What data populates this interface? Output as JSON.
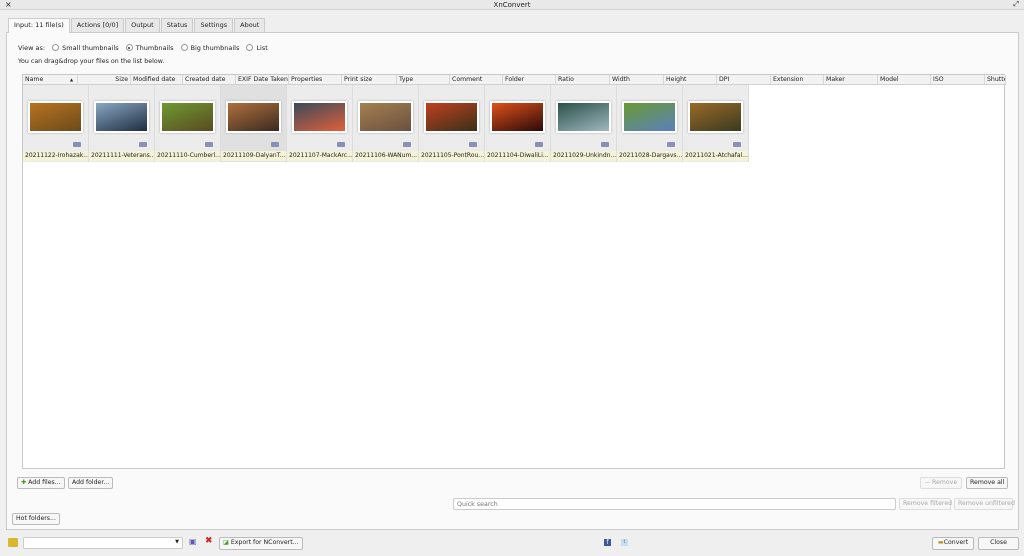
{
  "window": {
    "title": "XnConvert",
    "close_icon": "×",
    "restore_icon": "⤢"
  },
  "tabs": [
    {
      "label": "Input: 11 file(s)"
    },
    {
      "label": "Actions [0/0]"
    },
    {
      "label": "Output"
    },
    {
      "label": "Status"
    },
    {
      "label": "Settings"
    },
    {
      "label": "About"
    }
  ],
  "view": {
    "label": "View as:",
    "options": [
      {
        "label": "Small thumbnails",
        "selected": false
      },
      {
        "label": "Thumbnails",
        "selected": true
      },
      {
        "label": "Big thumbnails",
        "selected": false
      },
      {
        "label": "List",
        "selected": false
      }
    ],
    "hint": "You can drag&drop your files on the list below."
  },
  "columns": [
    "Name",
    "Size",
    "Modified date",
    "Created date",
    "EXIF Date Taken",
    "Properties",
    "Print size",
    "Type",
    "Comment",
    "Folder",
    "Ratio",
    "Width",
    "Height",
    "DPI",
    "Extension",
    "Maker",
    "Model",
    "ISO",
    "Shutte"
  ],
  "sort_icon": "▲",
  "files": [
    {
      "name": "20211122-Irohazak...",
      "colors": [
        "#6b4a1c",
        "#b8731f"
      ]
    },
    {
      "name": "20211111-Veterans...",
      "colors": [
        "#1e2d40",
        "#8aa8c4"
      ]
    },
    {
      "name": "20211110-Cumberl...",
      "colors": [
        "#5a4a22",
        "#6e9a30"
      ]
    },
    {
      "name": "20211109-DalyanT...",
      "colors": [
        "#3a2a20",
        "#b0703c"
      ]
    },
    {
      "name": "20211107-MackArc...",
      "colors": [
        "#e0603a",
        "#3a4a5a"
      ]
    },
    {
      "name": "20211106-WANum...",
      "colors": [
        "#6a5040",
        "#a48050"
      ]
    },
    {
      "name": "20211105-PontRou...",
      "colors": [
        "#3a3018",
        "#c04020"
      ]
    },
    {
      "name": "20211104-DiwaliLi...",
      "colors": [
        "#2a0a08",
        "#e0501a"
      ]
    },
    {
      "name": "20211029-Unkindn...",
      "colors": [
        "#a0b8c0",
        "#2a5048"
      ]
    },
    {
      "name": "20211028-Dargavs...",
      "colors": [
        "#5a80c0",
        "#6a9a30"
      ]
    },
    {
      "name": "20211021-Atchafal...",
      "colors": [
        "#3a3a20",
        "#9a6a28"
      ]
    }
  ],
  "buttons": {
    "add_files": "Add files...",
    "add_folder": "Add folder...",
    "remove": "Remove",
    "remove_all": "Remove all",
    "remove_filtered": "Remove filtered",
    "remove_unfiltered": "Remove unfiltered",
    "hot_folders": "Hot folders...",
    "export": "Export for NConvert...",
    "convert": "Convert",
    "close": "Close"
  },
  "search": {
    "placeholder": "Quick search",
    "value": ""
  },
  "preset": {
    "value": ""
  }
}
